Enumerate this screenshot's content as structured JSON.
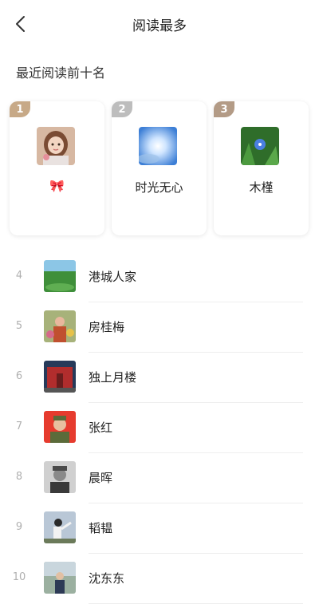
{
  "header": {
    "title": "阅读最多",
    "back_icon": "chevron-left-icon"
  },
  "section": {
    "title": "最近阅读前十名"
  },
  "top3": [
    {
      "rank": "1",
      "name": "🎀",
      "badge_color": "#c7a987",
      "avatar": "girl-portrait"
    },
    {
      "rank": "2",
      "name": "时光无心",
      "badge_color": "#bdbdbd",
      "avatar": "blue-sky-sun"
    },
    {
      "rank": "3",
      "name": "木槿",
      "badge_color": "#b39b86",
      "avatar": "blue-flower"
    }
  ],
  "list": [
    {
      "rank": "4",
      "name": "港城人家",
      "avatar": "green-landscape"
    },
    {
      "rank": "5",
      "name": "房桂梅",
      "avatar": "flowers-photo"
    },
    {
      "rank": "6",
      "name": "独上月楼",
      "avatar": "red-building"
    },
    {
      "rank": "7",
      "name": "张红",
      "avatar": "red-background-portrait"
    },
    {
      "rank": "8",
      "name": "晨晖",
      "avatar": "bw-portrait"
    },
    {
      "rank": "9",
      "name": "韬韫",
      "avatar": "dancer-photo"
    },
    {
      "rank": "10",
      "name": "沈东东",
      "avatar": "man-outdoor"
    }
  ]
}
